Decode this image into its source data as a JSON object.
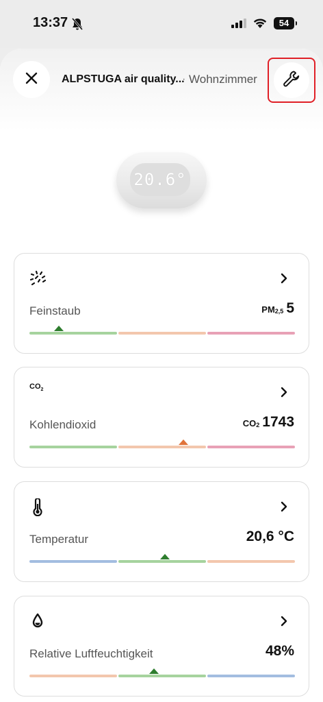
{
  "status_bar": {
    "time": "13:37",
    "battery": "54"
  },
  "header": {
    "title": "ALPSTUGA air quality...",
    "separator": "·",
    "room": "Wohnzimmer"
  },
  "device": {
    "display": "20.6°"
  },
  "colors": {
    "green": "#a6d39e",
    "orange": "#f3c7ad",
    "pink": "#e8a1b6",
    "blue": "#a3bde0",
    "marker_green": "#2e7d2e",
    "marker_orange": "#e0733a",
    "highlight_red": "#e01f26"
  },
  "cards": [
    {
      "icon": "particles-icon",
      "label": "Feinstaub",
      "value_prefix": "PM",
      "value_prefix_sub": "2,5",
      "value": "5",
      "scale_colors": [
        "green",
        "orange",
        "pink"
      ],
      "marker_level": 0.11,
      "marker_color": "marker_green"
    },
    {
      "icon": "co2-icon",
      "icon_text": "CO",
      "icon_text_sub": "2",
      "label": "Kohlendioxid",
      "value_prefix": "CO",
      "value_prefix_sub": "2",
      "value": "1743",
      "scale_colors": [
        "green",
        "orange",
        "pink"
      ],
      "marker_level": 0.58,
      "marker_color": "marker_orange"
    },
    {
      "icon": "thermometer-icon",
      "label": "Temperatur",
      "value": "20,6 °C",
      "scale_colors": [
        "blue",
        "green",
        "orange"
      ],
      "marker_level": 0.51,
      "marker_color": "marker_green"
    },
    {
      "icon": "water-drop-icon",
      "label": "Relative Luftfeuchtigkeit",
      "value": "48%",
      "scale_colors": [
        "orange",
        "green",
        "blue"
      ],
      "marker_level": 0.47,
      "marker_color": "marker_green"
    }
  ]
}
